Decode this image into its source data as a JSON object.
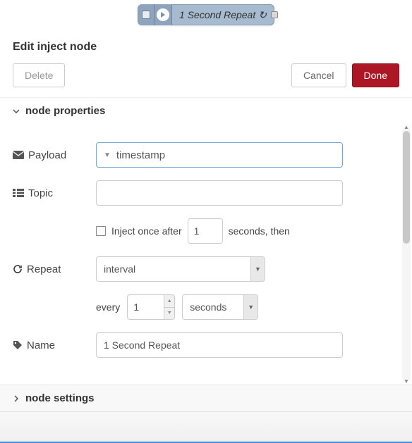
{
  "node": {
    "label": "1 Second Repeat",
    "repeat_glyph": "↻"
  },
  "panel": {
    "title": "Edit inject node",
    "delete": "Delete",
    "cancel": "Cancel",
    "done": "Done"
  },
  "sections": {
    "properties": "node properties",
    "settings": "node settings"
  },
  "form": {
    "payload": {
      "label": "Payload",
      "value": "timestamp"
    },
    "topic": {
      "label": "Topic",
      "value": ""
    },
    "inject_once": {
      "prefix": "Inject once after",
      "value": "1",
      "suffix": "seconds, then",
      "checked": false
    },
    "repeat": {
      "label": "Repeat",
      "mode": "interval",
      "every_label": "every",
      "every_value": "1",
      "unit": "seconds"
    },
    "name": {
      "label": "Name",
      "value": "1 Second Repeat"
    }
  }
}
